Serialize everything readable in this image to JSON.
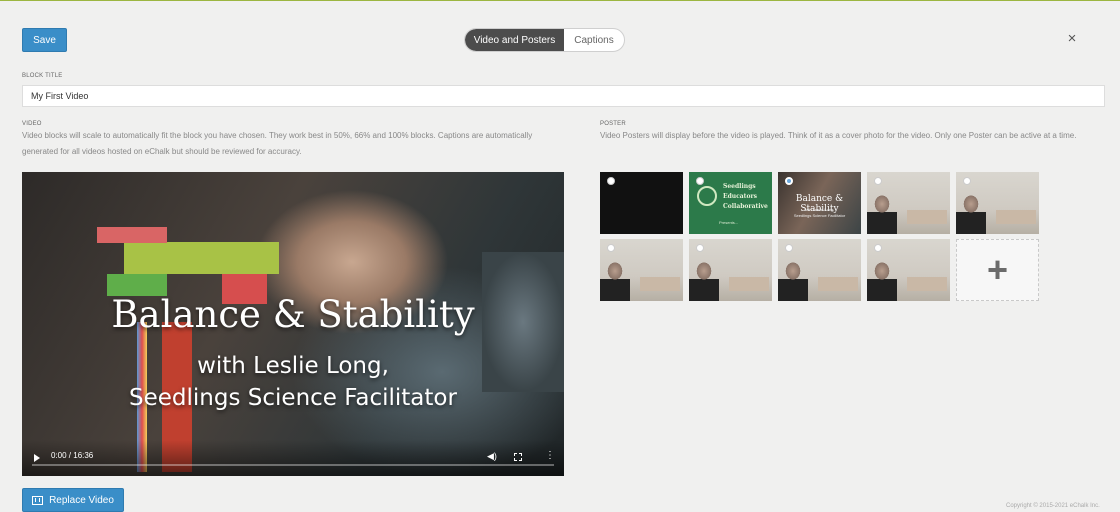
{
  "toolbar": {
    "save_label": "Save",
    "close_icon": "×"
  },
  "tabs": [
    {
      "label": "Video and Posters",
      "active": true
    },
    {
      "label": "Captions",
      "active": false
    }
  ],
  "block_title": {
    "label": "BLOCK TITLE",
    "value": "My First Video"
  },
  "video": {
    "label": "VIDEO",
    "help": "Video blocks will scale to automatically fit the block you have chosen. They work best in 50%, 66% and 100% blocks. Captions are automatically generated for all videos hosted on eChalk but should be reviewed for accuracy.",
    "title_line1": "Balance & Stability",
    "title_line2": "with Leslie Long,",
    "title_line3": "Seedlings Science Facilitator",
    "time": "0:00 / 16:36",
    "replace_label": "Replace Video"
  },
  "poster": {
    "label": "POSTER",
    "help": "Video Posters will display before the video is played. Think of it as a cover photo for the video. Only one Poster can be active at a time.",
    "green_text": [
      "Seedlings",
      "Educators",
      "Collaborative"
    ],
    "green_presents": "Presents...",
    "video_thumb_title": "Balance & Stability",
    "video_thumb_sub": [
      "with Leslie Long,",
      "Seedlings Science Facilitator"
    ],
    "add_icon": "+"
  },
  "footer": {
    "copyright": "Copyright © 2015-2021 eChalk Inc."
  },
  "colors": {
    "primary": "#3a8ec8",
    "accent_line": "#9cb640",
    "dark_tab": "#4c4c4c"
  }
}
